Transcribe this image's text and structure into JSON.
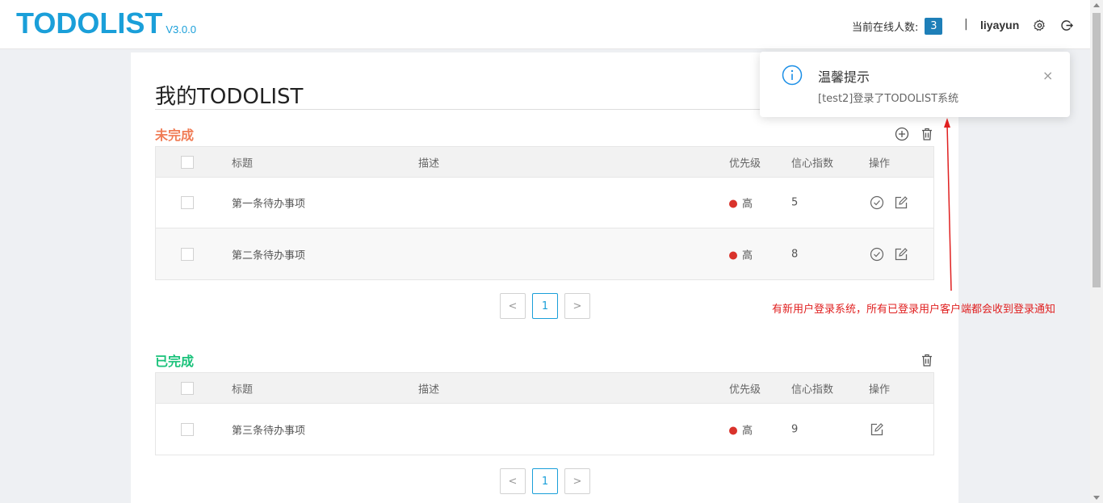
{
  "header": {
    "logo": "TODOLIST",
    "version": "V3.0.0",
    "online_label": "当前在线人数:",
    "online_count": "3",
    "separator": "|",
    "username": "liyayun"
  },
  "main": {
    "title": "我的TODOLIST",
    "columns": {
      "title": "标题",
      "desc": "描述",
      "priority": "优先级",
      "confidence": "信心指数",
      "action": "操作"
    },
    "undone": {
      "heading": "未完成",
      "rows": [
        {
          "title": "第一条待办事项",
          "desc": "",
          "priority": "高",
          "confidence": "5"
        },
        {
          "title": "第二条待办事项",
          "desc": "",
          "priority": "高",
          "confidence": "8"
        }
      ],
      "pager": {
        "page": "1",
        "prev": "<",
        "next": ">"
      }
    },
    "done": {
      "heading": "已完成",
      "rows": [
        {
          "title": "第三条待办事项",
          "desc": "",
          "priority": "高",
          "confidence": "9"
        }
      ],
      "pager": {
        "page": "1",
        "prev": "<",
        "next": ">"
      }
    }
  },
  "notification": {
    "title": "温馨提示",
    "message": "[test2]登录了TODOLIST系统",
    "close": "×"
  },
  "annotation": "有新用户登录系统，所有已登录用户客户端都会收到登录通知",
  "colors": {
    "brand": "#1a9fd9",
    "undone": "#f07c55",
    "done": "#19c27a",
    "priority_high": "#d9322b",
    "annotation": "#e02020",
    "online_badge": "#1e7fb8"
  },
  "icons": [
    "settings-icon",
    "logout-icon",
    "add-icon",
    "delete-icon",
    "complete-icon",
    "edit-icon",
    "info-icon",
    "close-icon"
  ]
}
